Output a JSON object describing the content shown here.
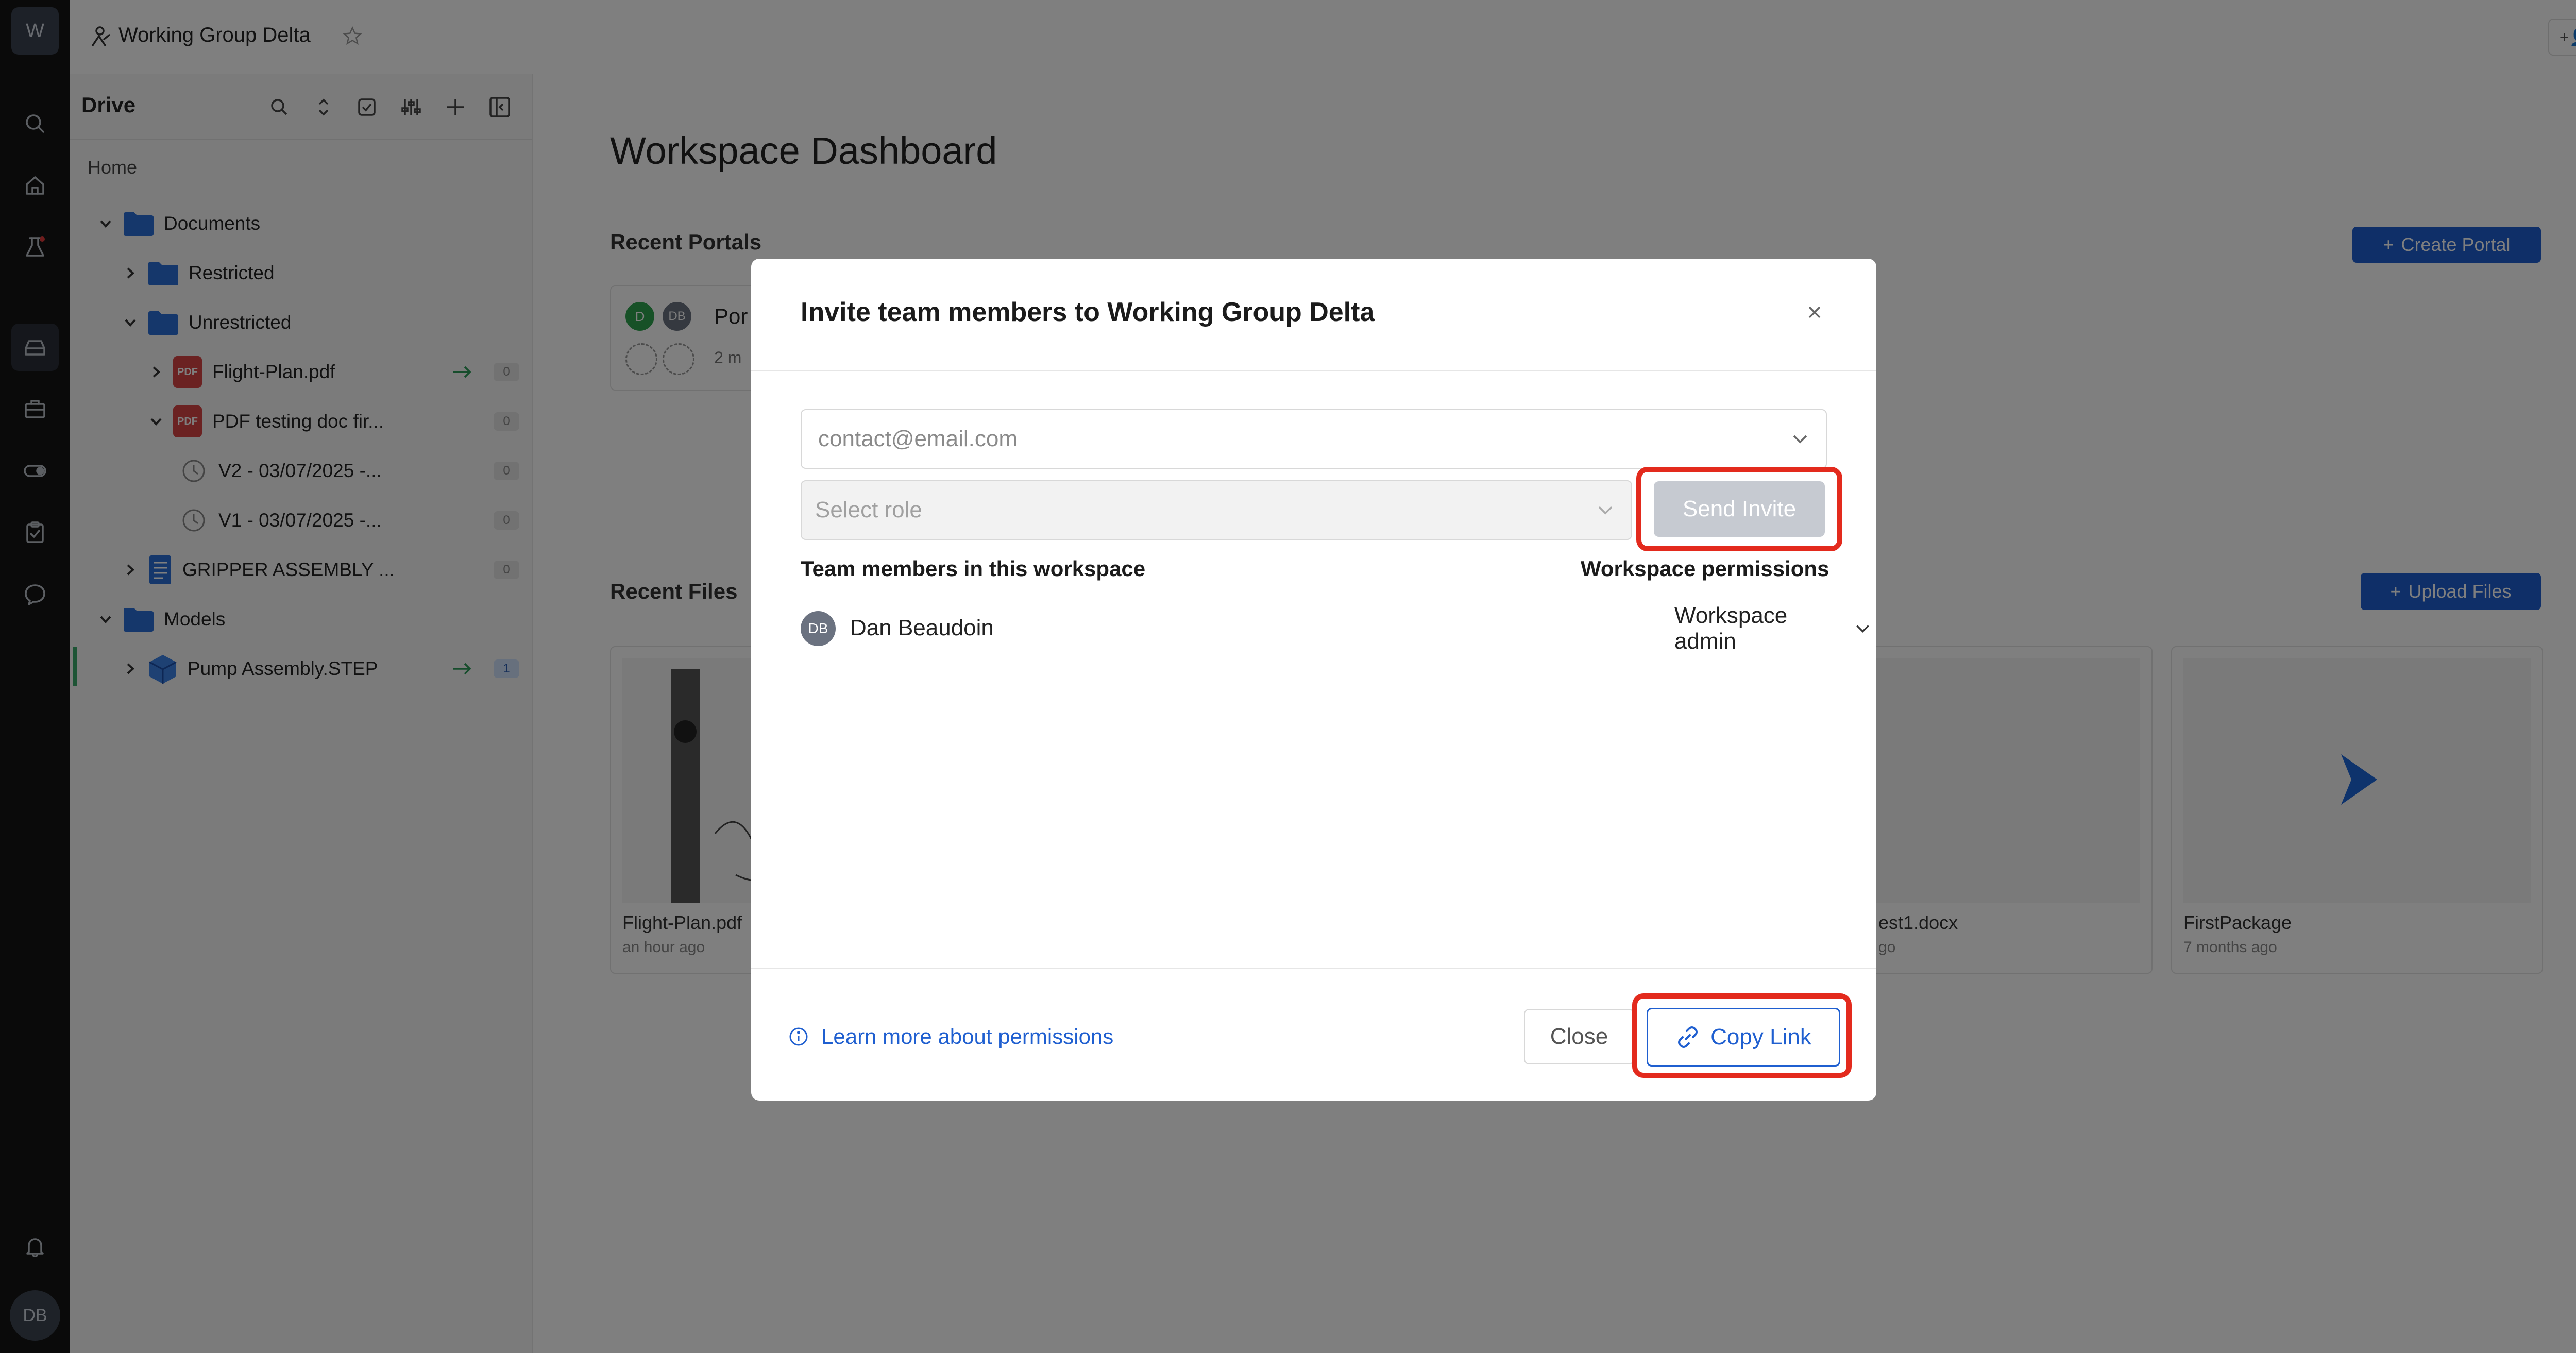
{
  "app": {
    "workspace_initial": "W",
    "workspace_name": "Working Group Delta",
    "user_initials": "DB",
    "member_count": "1"
  },
  "rail": {
    "icons": [
      "search-icon",
      "home-icon",
      "lab-flask-icon",
      "drive-icon",
      "briefcase-icon",
      "toggle-icon",
      "clipboard-icon",
      "chat-icon",
      "bell-icon"
    ]
  },
  "drive": {
    "title": "Drive",
    "home_label": "Home",
    "tree": [
      {
        "label": "Documents",
        "type": "folder"
      },
      {
        "label": "Restricted",
        "type": "folder"
      },
      {
        "label": "Unrestricted",
        "type": "folder"
      },
      {
        "label": "Flight-Plan.pdf",
        "type": "pdf",
        "count": "0"
      },
      {
        "label": "PDF testing doc fir...",
        "type": "pdf",
        "count": "0"
      },
      {
        "label": "V2 - 03/07/2025 -...",
        "type": "version",
        "count": "0"
      },
      {
        "label": "V1 - 03/07/2025 -...",
        "type": "version",
        "count": "0"
      },
      {
        "label": "GRIPPER ASSEMBLY ...",
        "type": "doc",
        "count": "0"
      },
      {
        "label": "Models",
        "type": "folder"
      },
      {
        "label": "Pump Assembly.STEP",
        "type": "model",
        "count": "1"
      }
    ],
    "pdf_badge": "PDF"
  },
  "main": {
    "title": "Workspace Dashboard",
    "recent_portals_label": "Recent Portals",
    "create_portal_label": "Create Portal",
    "portal_avatars": [
      "D",
      "DB"
    ],
    "portal_name_partial": "Por",
    "portal_time_partial": "2 m",
    "recent_files_label": "Recent Files",
    "upload_files_label": "Upload Files",
    "files": [
      {
        "name": "Flight-Plan.pdf",
        "time": "an hour ago"
      },
      {
        "name": "est1.docx",
        "time": "go"
      },
      {
        "name": "FirstPackage",
        "time": "7 months ago"
      }
    ]
  },
  "modal": {
    "title": "Invite team members to Working Group Delta",
    "email_placeholder": "contact@email.com",
    "role_placeholder": "Select role",
    "send_invite_label": "Send Invite",
    "members_header": "Team members in this workspace",
    "permissions_header": "Workspace permissions",
    "members": [
      {
        "initials": "DB",
        "name": "Dan Beaudoin",
        "permission": "Workspace admin"
      }
    ],
    "learn_more_label": "Learn more about permissions",
    "close_label": "Close",
    "copy_link_label": "Copy Link"
  },
  "colors": {
    "accent": "#1f5fd0",
    "highlight": "#e32a1d",
    "overlay": "rgba(0,0,0,0.5)"
  }
}
